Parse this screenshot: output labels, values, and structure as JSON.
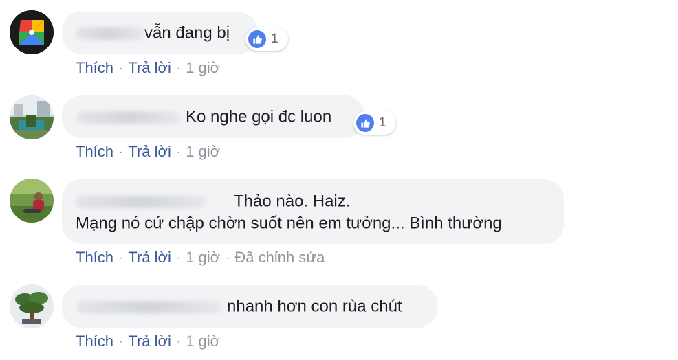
{
  "colors": {
    "bubble_bg": "#f2f3f5",
    "link": "#385898",
    "meta": "#8d949e",
    "like_blue": "#4f7ff0"
  },
  "comments": [
    {
      "text": "vẫn đang bị",
      "reaction_icon": "like-icon",
      "reaction_count": "1",
      "actions": {
        "like": "Thích",
        "reply": "Trả lời",
        "time": "1 giờ"
      }
    },
    {
      "text": "Ko nghe gọi đc luon",
      "reaction_icon": "like-icon",
      "reaction_count": "1",
      "actions": {
        "like": "Thích",
        "reply": "Trả lời",
        "time": "1 giờ"
      }
    },
    {
      "text_line1": "Thảo nào. Haiz.",
      "text_line2": "Mạng nó cứ chập chờn suốt nên em tưởng... Bình thường",
      "actions": {
        "like": "Thích",
        "reply": "Trả lời",
        "time": "1 giờ",
        "edited": "Đã chỉnh sửa"
      }
    },
    {
      "text": "nhanh hơn con rùa chút",
      "actions": {
        "like": "Thích",
        "reply": "Trả lời",
        "time": "1 giờ"
      }
    }
  ]
}
